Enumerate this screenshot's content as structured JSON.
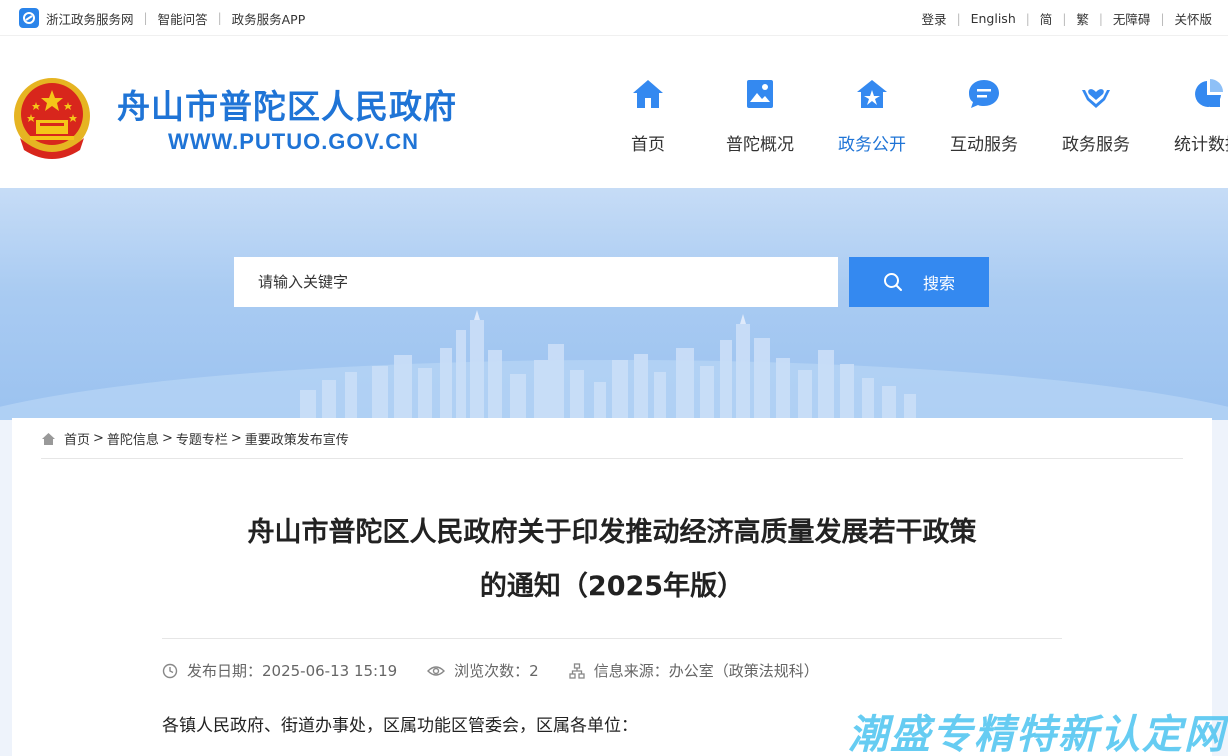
{
  "topbar": {
    "left_links": [
      "浙江政务服务网",
      "智能问答",
      "政务服务APP"
    ],
    "right_links": [
      "登录",
      "English",
      "简",
      "繁",
      "无障碍",
      "关怀版"
    ]
  },
  "header": {
    "site_name": "舟山市普陀区人民政府",
    "site_url": "WWW.PUTUO.GOV.CN",
    "nav": [
      {
        "label": "首页",
        "icon": "home-icon"
      },
      {
        "label": "普陀概况",
        "icon": "landscape-icon"
      },
      {
        "label": "政务公开",
        "icon": "star-house-icon"
      },
      {
        "label": "互动服务",
        "icon": "chat-icon"
      },
      {
        "label": "政务服务",
        "icon": "heart-hand-icon"
      },
      {
        "label": "统计数据",
        "icon": "pie-chart-icon"
      }
    ],
    "active_nav": "政务公开",
    "accent_color": "#1f74d6"
  },
  "search": {
    "placeholder": "请输入关键字",
    "button_label": "搜索"
  },
  "breadcrumb": [
    "首页",
    "普陀信息",
    "专题专栏",
    "重要政策发布宣传"
  ],
  "article": {
    "title_line1": "舟山市普陀区人民政府关于印发推动经济高质量发展若干政策",
    "title_line2": "的通知（2025年版）",
    "publish_date": "发布日期：2025-06-13 15:19",
    "views": "浏览次数：2",
    "source": "信息来源：办公室（政策法规科）",
    "greeting": "各镇人民政府、街道办事处，区属功能区管委会，区属各单位："
  },
  "watermark": "潮盛专精特新认定网"
}
